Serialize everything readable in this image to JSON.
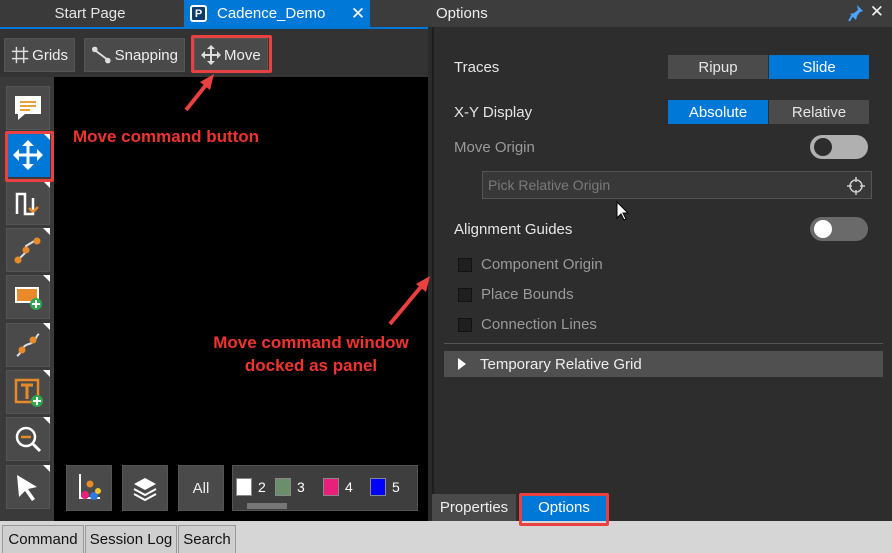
{
  "tabs": {
    "start_page": "Start Page",
    "cadence": "Cadence_Demo",
    "close_glyph": "✕"
  },
  "toolbar": {
    "grids": "Grids",
    "snapping": "Snapping",
    "move": "Move"
  },
  "left_tools": [
    "comment-icon",
    "move-icon",
    "route-icon",
    "connect-icon",
    "place-shape-icon",
    "fanout-icon",
    "add-text-icon",
    "zoom-icon",
    "select-icon"
  ],
  "bottom_tools": {
    "all": "All",
    "layers": [
      {
        "num": "2",
        "color": "#ffffff"
      },
      {
        "num": "3",
        "color": "#6b8f6b"
      },
      {
        "num": "4",
        "color": "#e8207a"
      },
      {
        "num": "5",
        "color": "#0000ff"
      }
    ]
  },
  "options": {
    "title": "Options",
    "traces_label": "Traces",
    "traces_options": [
      "Ripup",
      "Slide"
    ],
    "traces_selected": "Slide",
    "xy_label": "X-Y Display",
    "xy_options": [
      "Absolute",
      "Relative"
    ],
    "xy_selected": "Absolute",
    "move_origin_label": "Move Origin",
    "pick_placeholder": "Pick Relative Origin",
    "alignment_label": "Alignment Guides",
    "checkboxes": [
      "Component Origin",
      "Place Bounds",
      "Connection Lines"
    ],
    "temp_grid_label": "Temporary Relative Grid"
  },
  "panel_tabs": {
    "properties": "Properties",
    "options": "Options"
  },
  "status_tabs": [
    "Command",
    "Session Log",
    "Search"
  ],
  "annotations": {
    "move_button": "Move command button",
    "window_line1": "Move command window",
    "window_line2": "docked as panel"
  },
  "colors": {
    "accent": "#0078d7",
    "annotation": "#e8413f"
  }
}
